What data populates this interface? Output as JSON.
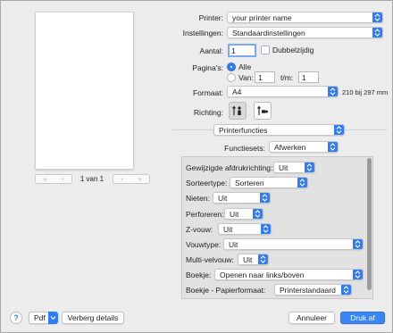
{
  "preview": {
    "page_indicator": "1 van 1"
  },
  "printer": {
    "label": "Printer:",
    "value": "your printer name"
  },
  "presets": {
    "label": "Instellingen:",
    "value": "Standaardinstellingen"
  },
  "copies": {
    "label": "Aantal:",
    "value": "1",
    "double_sided_label": "Dubbelzijdig"
  },
  "pages": {
    "label": "Pagina's:",
    "all_label": "Alle",
    "from_label": "Van:",
    "from_value": "1",
    "to_label": "t/m:",
    "to_value": "1"
  },
  "paper_size": {
    "label": "Formaat:",
    "value": "A4",
    "dimensions": "210 bij 297 mm"
  },
  "orientation": {
    "label": "Richting:"
  },
  "section_popup": {
    "value": "Printerfuncties"
  },
  "feature_sets": {
    "label": "Functiesets:",
    "value": "Afwerken"
  },
  "features": [
    {
      "label": "Gewijzigde afdrukrichting:",
      "value": "Uit"
    },
    {
      "label": "Sorteertype:",
      "value": "Sorteren"
    },
    {
      "label": "Nieten:",
      "value": "Uit"
    },
    {
      "label": "Perforeren:",
      "value": "Uit"
    },
    {
      "label": "Z-vouw:",
      "value": "Uit"
    },
    {
      "label": "Vouwtype:",
      "value": "Uit"
    },
    {
      "label": "Multi-velvouw:",
      "value": "Uit"
    },
    {
      "label": "Boekje:",
      "value": "Openen naar links/boven"
    },
    {
      "label": "Boekje - Papierformaat:",
      "value": "Printerstandaard"
    }
  ],
  "footer": {
    "help_label": "?",
    "pdf_label": "Pdf",
    "hide_details_label": "Verberg details",
    "cancel_label": "Annuleer",
    "print_label": "Druk af"
  },
  "colors": {
    "accent": "#2f7cf6",
    "primary_button": "#3a86f7"
  }
}
